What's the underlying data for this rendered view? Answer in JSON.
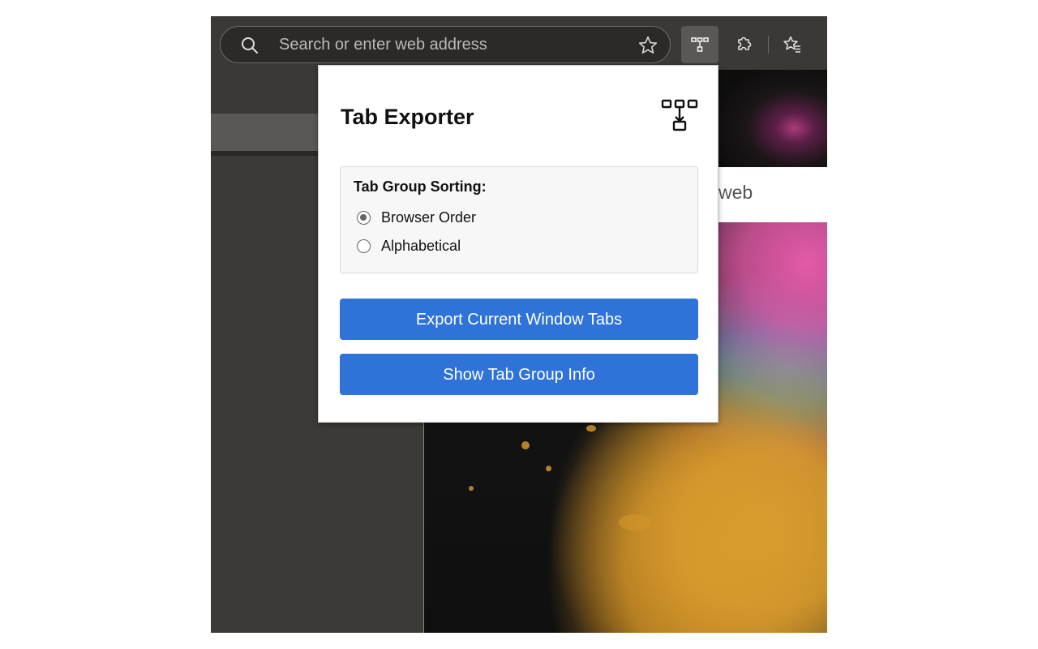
{
  "address_bar": {
    "placeholder": "Search or enter web address",
    "search_icon": "search-icon",
    "favorite_icon": "star-icon"
  },
  "toolbar": {
    "extension_icon": "tab-exporter-icon",
    "extensions_icon": "puzzle-icon",
    "favorites_icon": "favorites-star-icon"
  },
  "page": {
    "partial_text": "web"
  },
  "popup": {
    "title": "Tab Exporter",
    "logo_icon": "tab-exporter-logo-icon",
    "sorting": {
      "label": "Tab Group Sorting:",
      "options": [
        {
          "label": "Browser Order",
          "selected": true
        },
        {
          "label": "Alphabetical",
          "selected": false
        }
      ]
    },
    "buttons": {
      "export_label": "Export Current Window Tabs",
      "info_label": "Show Tab Group Info"
    }
  },
  "colors": {
    "browser_chrome": "#3b3936",
    "button_blue": "#2f73d8",
    "popup_bg": "#ffffff"
  }
}
